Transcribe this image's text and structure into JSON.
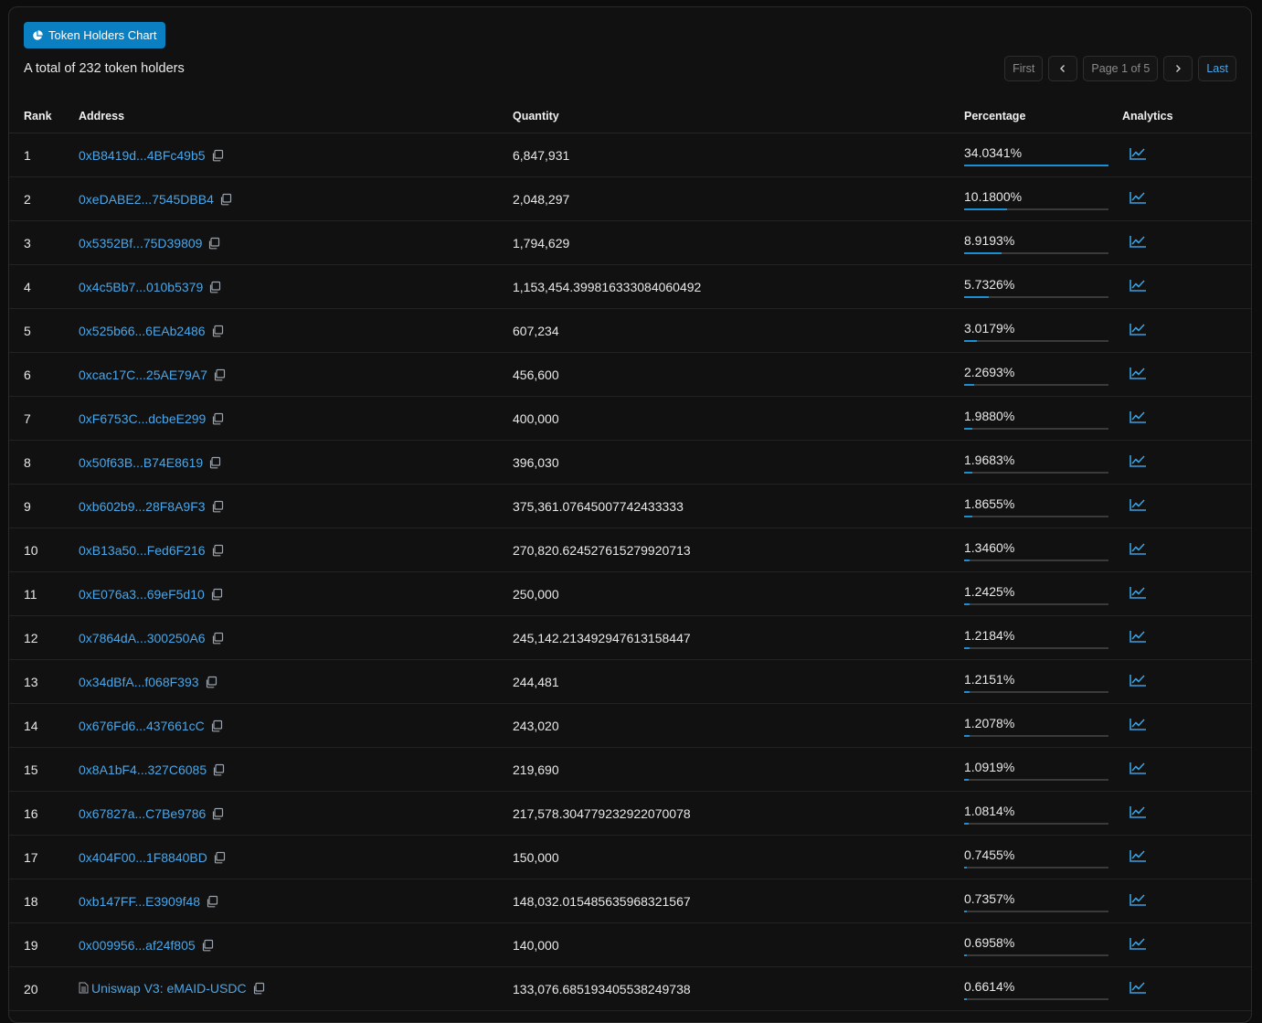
{
  "chart_button": {
    "label": "Token Holders Chart",
    "icon": "pie-chart-icon"
  },
  "summary": "A total of 232 token holders",
  "pager": {
    "first": "First",
    "page": "Page 1 of 5",
    "last": "Last"
  },
  "columns": {
    "rank": "Rank",
    "address": "Address",
    "quantity": "Quantity",
    "percentage": "Percentage",
    "analytics": "Analytics"
  },
  "accent_color": "#1a8fd6",
  "link_color": "#4aa6e8",
  "rows": [
    {
      "rank": "1",
      "address": "0xB8419d...4BFc49b5",
      "quantity": "6,847,931",
      "percentage": "34.0341%",
      "pct_value": 34.0341
    },
    {
      "rank": "2",
      "address": "0xeDABE2...7545DBB4",
      "quantity": "2,048,297",
      "percentage": "10.1800%",
      "pct_value": 10.18
    },
    {
      "rank": "3",
      "address": "0x5352Bf...75D39809",
      "quantity": "1,794,629",
      "percentage": "8.9193%",
      "pct_value": 8.9193
    },
    {
      "rank": "4",
      "address": "0x4c5Bb7...010b5379",
      "quantity": "1,153,454.399816333084060492",
      "percentage": "5.7326%",
      "pct_value": 5.7326
    },
    {
      "rank": "5",
      "address": "0x525b66...6EAb2486",
      "quantity": "607,234",
      "percentage": "3.0179%",
      "pct_value": 3.0179
    },
    {
      "rank": "6",
      "address": "0xcac17C...25AE79A7",
      "quantity": "456,600",
      "percentage": "2.2693%",
      "pct_value": 2.2693
    },
    {
      "rank": "7",
      "address": "0xF6753C...dcbeE299",
      "quantity": "400,000",
      "percentage": "1.9880%",
      "pct_value": 1.988
    },
    {
      "rank": "8",
      "address": "0x50f63B...B74E8619",
      "quantity": "396,030",
      "percentage": "1.9683%",
      "pct_value": 1.9683
    },
    {
      "rank": "9",
      "address": "0xb602b9...28F8A9F3",
      "quantity": "375,361.07645007742433333",
      "percentage": "1.8655%",
      "pct_value": 1.8655
    },
    {
      "rank": "10",
      "address": "0xB13a50...Fed6F216",
      "quantity": "270,820.624527615279920713",
      "percentage": "1.3460%",
      "pct_value": 1.346
    },
    {
      "rank": "11",
      "address": "0xE076a3...69eF5d10",
      "quantity": "250,000",
      "percentage": "1.2425%",
      "pct_value": 1.2425
    },
    {
      "rank": "12",
      "address": "0x7864dA...300250A6",
      "quantity": "245,142.213492947613158447",
      "percentage": "1.2184%",
      "pct_value": 1.2184
    },
    {
      "rank": "13",
      "address": "0x34dBfA...f068F393",
      "quantity": "244,481",
      "percentage": "1.2151%",
      "pct_value": 1.2151
    },
    {
      "rank": "14",
      "address": "0x676Fd6...437661cC",
      "quantity": "243,020",
      "percentage": "1.2078%",
      "pct_value": 1.2078
    },
    {
      "rank": "15",
      "address": "0x8A1bF4...327C6085",
      "quantity": "219,690",
      "percentage": "1.0919%",
      "pct_value": 1.0919
    },
    {
      "rank": "16",
      "address": "0x67827a...C7Be9786",
      "quantity": "217,578.304779232922070078",
      "percentage": "1.0814%",
      "pct_value": 1.0814
    },
    {
      "rank": "17",
      "address": "0x404F00...1F8840BD",
      "quantity": "150,000",
      "percentage": "0.7455%",
      "pct_value": 0.7455
    },
    {
      "rank": "18",
      "address": "0xb147FF...E3909f48",
      "quantity": "148,032.015485635968321567",
      "percentage": "0.7357%",
      "pct_value": 0.7357
    },
    {
      "rank": "19",
      "address": "0x009956...af24f805",
      "quantity": "140,000",
      "percentage": "0.6958%",
      "pct_value": 0.6958
    },
    {
      "rank": "20",
      "address": "Uniswap V3: eMAID-USDC",
      "quantity": "133,076.685193405538249738",
      "percentage": "0.6614%",
      "pct_value": 0.6614,
      "is_contract": true
    }
  ]
}
